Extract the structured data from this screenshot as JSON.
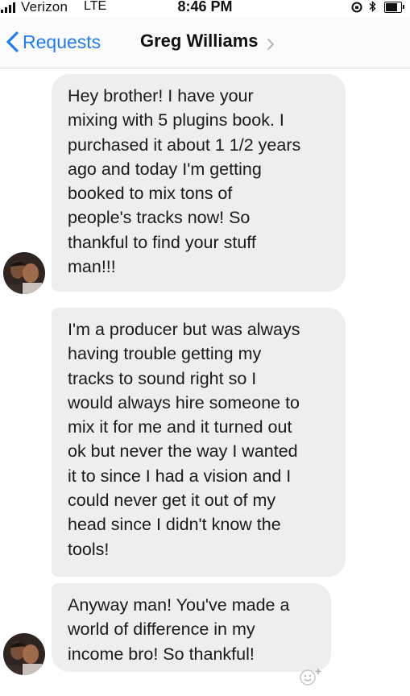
{
  "status_bar": {
    "carrier": "Verizon",
    "network": "LTE",
    "time": "8:46 PM"
  },
  "nav": {
    "back_label": "Requests",
    "contact_name": "Greg Williams"
  },
  "messages": [
    {
      "text": "Hey brother! I have your\nmixing with 5 plugins book. I\npurchased it about 1 1/2 years\nago and today I'm getting\nbooked to mix tons of\npeople's tracks now! So\nthankful to find your stuff\nman!!!"
    },
    {
      "text": "I'm a producer but was always\nhaving trouble getting my\ntracks to sound right so I\nwould always hire someone to\nmix it for me and it turned out\nok but never the way I wanted\nit to since I had a vision and I\ncould never get it out of my\nhead since I didn't know the\ntools!"
    },
    {
      "text": "Anyway man! You've made a\nworld of difference in my\nincome bro! So thankful!"
    }
  ],
  "colors": {
    "accent": "#1f7cf6",
    "bubble": "#eeeeef"
  },
  "icons": {
    "back": "chevron-left-icon",
    "contact_detail": "chevron-right-icon",
    "reaction": "smiley-plus-icon"
  }
}
